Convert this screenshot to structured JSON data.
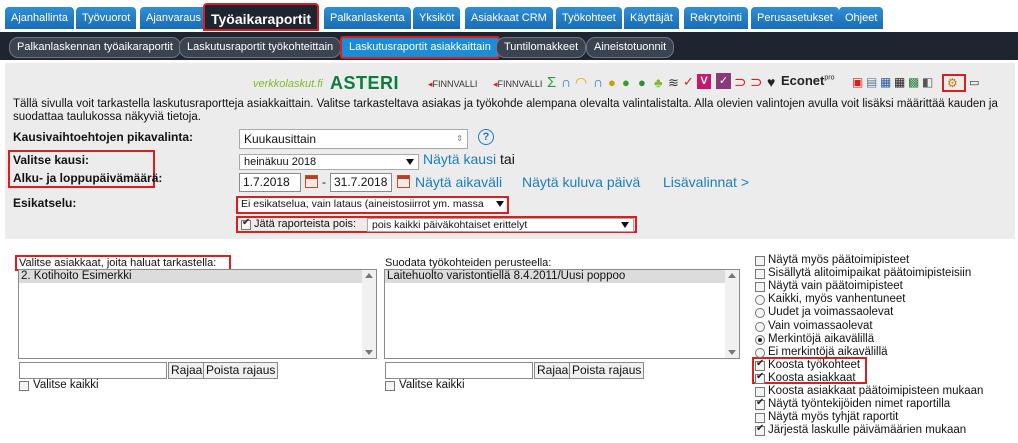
{
  "tabs": [
    "Ajanhallinta",
    "Työvuorot",
    "Ajanvaraus",
    "Työaikaraportit",
    "Palkanlaskenta",
    "Yksiköt",
    "Asiakkaat CRM",
    "Työkohteet",
    "Käyttäjät",
    "Rekrytointi",
    "Perusasetukset",
    "Ohjeet"
  ],
  "subtabs": [
    "Palkanlaskennan työaikaraportit",
    "Laskutusraportit työkohteittain",
    "Laskutusraportit asiakkaittain",
    "Tuntilomakkeet",
    "Aineistotuonnit"
  ],
  "toolbar": {
    "verkkolaskut": "verkkolaskut.fi",
    "asteri": "ASTERI",
    "finnvalli": "FINNVALLI",
    "finnvalli2": "FINNVALLI",
    "econet": "Econet",
    "pro": "pro"
  },
  "info_text": "Tällä sivulla voit tarkastella laskutusraportteja asiakkaittain. Valitse tarkasteltava asiakas ja työkohde alempana olevalta valintalistalta. Alla olevien valintojen avulla voit lisäksi määrittää kauden ja suodattaa taulukossa näkyviä tietoja.",
  "form": {
    "quick_label": "Kausivaihtoehtojen pikavalinta:",
    "quick_value": "Kuukausittain",
    "help": "?",
    "period_label": "Valitse kausi:",
    "period_value": "heinäkuu 2018",
    "show_period": "Näytä kausi",
    "or": "tai",
    "range_label": "Alku- ja loppupäivämäärä:",
    "start": "1.7.2018",
    "dash": "-",
    "end": "31.7.2018",
    "show_range": "Näytä aikaväli",
    "show_current": "Näytä kuluva päivä",
    "more": "Lisävalinnat >",
    "preview_label": "Esikatselu:",
    "preview_value": "Ei esikatselua, vain lataus (aineistosiirrot ym. massa",
    "exclude_label": "Jätä raporteista pois:",
    "exclude_value": "pois kaikki päiväkohtaiset erittelyt"
  },
  "customers": {
    "label": "Valitse asiakkaat, joita haluat tarkastella:",
    "item": "2. Kotihoito Esimerkki",
    "filter": "Rajaa",
    "clear": "Poista rajaus",
    "select_all": "Valitse kaikki"
  },
  "worksites": {
    "label": "Suodata työkohteiden perusteella:",
    "item": "Laitehuolto varistontiellä 8.4.2011/Uusi poppoo",
    "filter": "Rajaa",
    "clear": "Poista rajaus",
    "select_all": "Valitse kaikki"
  },
  "options": [
    {
      "label": "Näytä myös päätoimipisteet",
      "type": "checkbox",
      "checked": false
    },
    {
      "label": "Sisällytä alitoimipaikat päätoimipisteisiin",
      "type": "checkbox",
      "checked": false
    },
    {
      "label": "Näytä vain päätoimipisteet",
      "type": "checkbox",
      "checked": false
    },
    {
      "label": "Kaikki, myös vanhentuneet",
      "type": "radio",
      "checked": false
    },
    {
      "label": "Uudet ja voimassaolevat",
      "type": "radio",
      "checked": false
    },
    {
      "label": "Vain voimassaolevat",
      "type": "radio",
      "checked": false
    },
    {
      "label": "Merkintöjä aikavälillä",
      "type": "radio",
      "checked": true
    },
    {
      "label": "Ei merkintöjä aikavälillä",
      "type": "radio",
      "checked": false
    },
    {
      "label": "Koosta työkohteet",
      "type": "checkbox",
      "checked": true
    },
    {
      "label": "Koosta asiakkaat",
      "type": "checkbox",
      "checked": true
    },
    {
      "label": "Koosta asiakkaat päätoimipisteen mukaan",
      "type": "checkbox",
      "checked": false
    },
    {
      "label": "Näytä työntekijöiden nimet raportilla",
      "type": "checkbox",
      "checked": true
    },
    {
      "label": "Näytä myös tyhjät raportit",
      "type": "checkbox",
      "checked": false
    },
    {
      "label": "Järjestä laskulle päivämäärien mukaan",
      "type": "checkbox",
      "checked": true
    }
  ]
}
